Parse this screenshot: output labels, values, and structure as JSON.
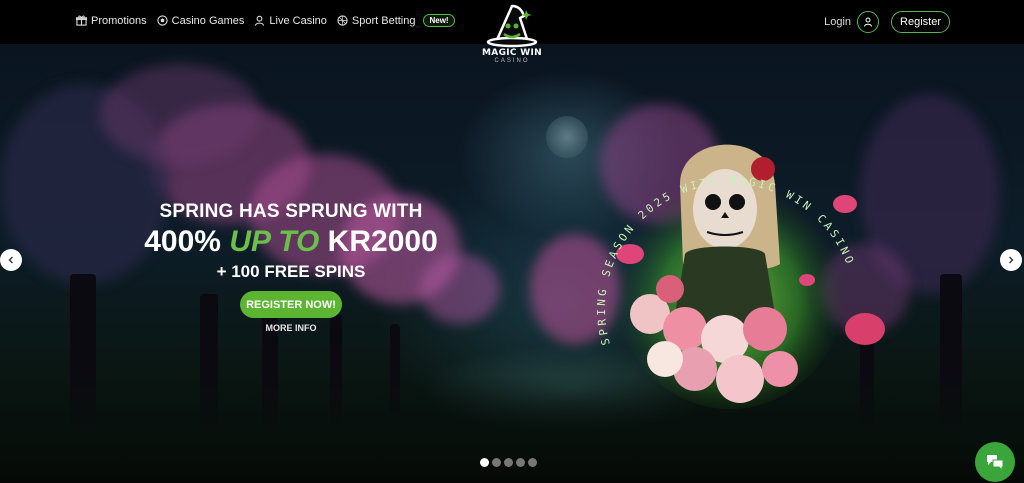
{
  "nav": {
    "items": [
      {
        "label": "Promotions",
        "icon": "gift-icon"
      },
      {
        "label": "Casino Games",
        "icon": "soccer-ball-icon"
      },
      {
        "label": "Live Casino",
        "icon": "dealer-icon"
      },
      {
        "label": "Sport Betting",
        "icon": "sport-ball-icon"
      }
    ],
    "new_badge": "New!"
  },
  "logo": {
    "title": "MAGIC WIN",
    "subtitle": "CASINO",
    "icon": "wizard-hat-icon"
  },
  "auth": {
    "login_label": "Login",
    "register_label": "Register"
  },
  "hero": {
    "line1": "SPRING HAS SPRUNG WITH",
    "line2_a": "400% ",
    "line2_green": "UP TO",
    "line2_b": " KR2000",
    "line3": "+ 100 FREE SPINS",
    "cta_label": "REGISTER NOW!",
    "more_info_label": "MORE INFO",
    "season_text": "SPRING SEASON 2025 WITH MAGIC WIN CASINO"
  },
  "carousel": {
    "dots": 5,
    "active_index": 0
  },
  "colors": {
    "accent_green": "#5cb531",
    "background": "#000000"
  }
}
